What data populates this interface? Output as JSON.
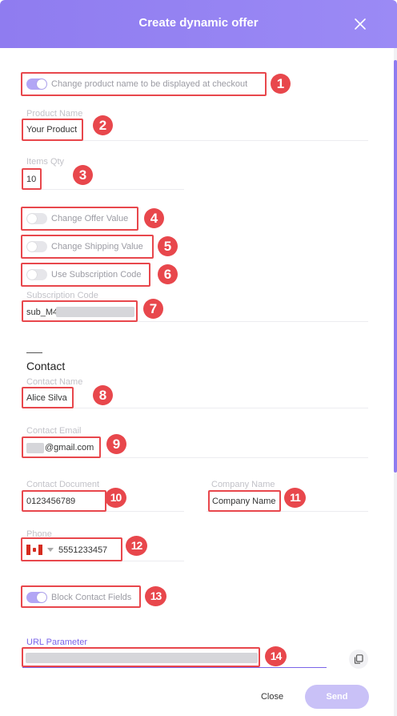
{
  "dialog": {
    "title": "Create dynamic offer"
  },
  "toggles": {
    "change_product_name": {
      "label": "Change product name to be displayed at checkout",
      "on": true
    },
    "change_offer_value": {
      "label": "Change Offer Value",
      "on": false
    },
    "change_shipping_value": {
      "label": "Change Shipping Value",
      "on": false
    },
    "use_subscription_code": {
      "label": "Use Subscription Code",
      "on": false
    },
    "block_contact_fields": {
      "label": "Block Contact Fields",
      "on": true
    }
  },
  "fields": {
    "product_name": {
      "label": "Product Name",
      "value": "Your Product"
    },
    "items_qty": {
      "label": "Items Qty",
      "value": "10"
    },
    "subscription_code": {
      "label": "Subscription Code",
      "value": "sub_M4"
    },
    "contact_name": {
      "label": "Contact Name",
      "value": "Alice Silva"
    },
    "contact_email": {
      "label": "Contact Email",
      "value": "@gmail.com"
    },
    "contact_document": {
      "label": "Contact Document",
      "value": "0123456789"
    },
    "company_name": {
      "label": "Company Name",
      "value": "Company Name"
    },
    "phone": {
      "label": "Phone",
      "value": "5551233457"
    },
    "url_parameter": {
      "label": "URL Parameter"
    }
  },
  "section": {
    "contact_title": "Contact"
  },
  "annotations": [
    "1",
    "2",
    "3",
    "4",
    "5",
    "6",
    "7",
    "8",
    "9",
    "10",
    "11",
    "12",
    "13",
    "14"
  ],
  "footer": {
    "close_label": "Close",
    "send_label": "Send"
  },
  "icons": {
    "close": "close-icon",
    "copy": "copy-icon",
    "flag": "canada-flag-icon",
    "caret": "chevron-down-icon"
  },
  "colors": {
    "header": "#8f7cf0",
    "accent": "#7a64e8",
    "toggle_on": "#b2a6f5",
    "annotation": "#e8474c",
    "send_button": "#c9c1f7"
  }
}
